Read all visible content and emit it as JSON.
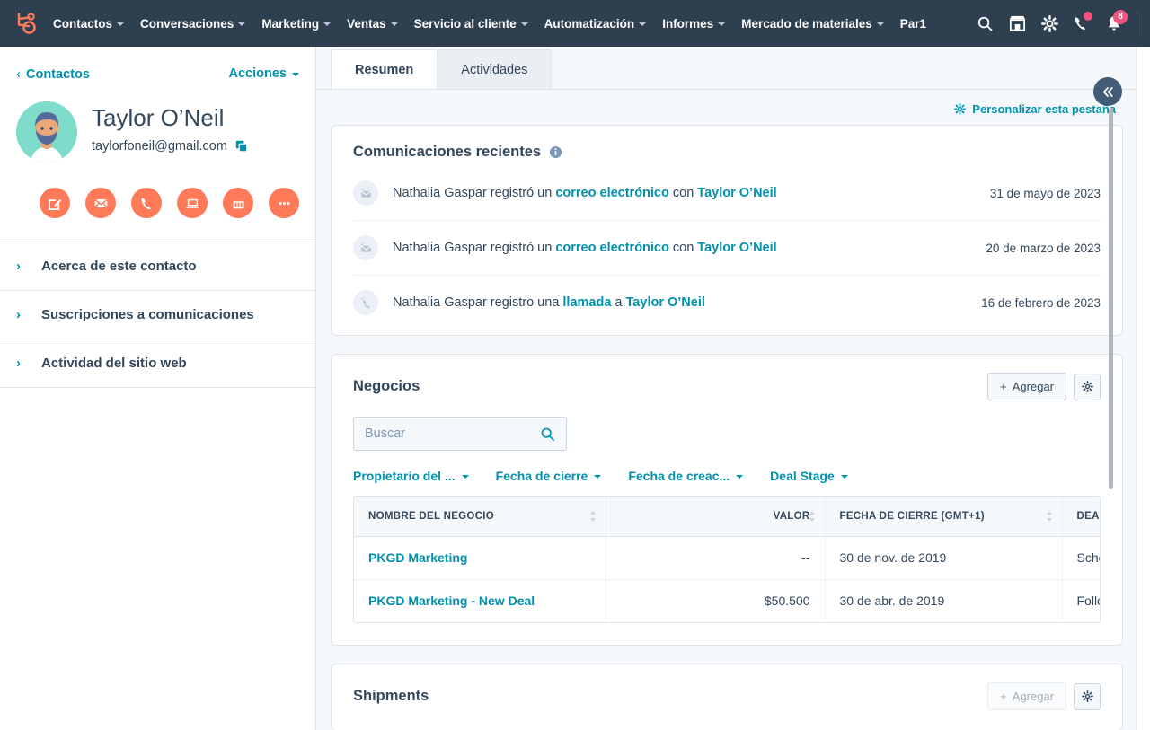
{
  "topnav": {
    "logo_name": "hubspot-logo",
    "menu": [
      {
        "label": "Contactos",
        "has_caret": true
      },
      {
        "label": "Conversaciones",
        "has_caret": true
      },
      {
        "label": "Marketing",
        "has_caret": true
      },
      {
        "label": "Ventas",
        "has_caret": true
      },
      {
        "label": "Servicio al cliente",
        "has_caret": true
      },
      {
        "label": "Automatización",
        "has_caret": true
      },
      {
        "label": "Informes",
        "has_caret": true
      },
      {
        "label": "Mercado de materiales",
        "has_caret": true
      },
      {
        "label": "Par1",
        "has_caret": false
      }
    ],
    "icons": {
      "search": "search-icon",
      "marketplace": "marketplace-icon",
      "settings": "gear-icon",
      "calls": "phone-icon",
      "notifications": "bell-icon"
    },
    "calls_badge": "",
    "notifications_badge": "8",
    "badge_color": "#f2547d",
    "background": "#2e3f50"
  },
  "sidebar": {
    "back_label": "Contactos",
    "actions_label": "Acciones",
    "contact": {
      "name": "Taylor O’Neil",
      "email": "taylorfoneil@gmail.com",
      "avatar_name": "contact-avatar",
      "copy_icon": "copy-icon"
    },
    "quick_actions": [
      {
        "name": "note-button",
        "icon": "note-icon"
      },
      {
        "name": "email-button",
        "icon": "envelope-icon"
      },
      {
        "name": "call-button",
        "icon": "phone-icon"
      },
      {
        "name": "meeting-button",
        "icon": "laptop-icon"
      },
      {
        "name": "task-button",
        "icon": "calendar-icon"
      },
      {
        "name": "more-button",
        "icon": "ellipsis-icon"
      }
    ],
    "sections": [
      {
        "label": "Acerca de este contacto",
        "expanded": false
      },
      {
        "label": "Suscripciones a comunicaciones",
        "expanded": false
      },
      {
        "label": "Actividad del sitio web",
        "expanded": false
      }
    ]
  },
  "main": {
    "tabs": [
      {
        "label": "Resumen",
        "active": true
      },
      {
        "label": "Actividades",
        "active": false
      }
    ],
    "customize_label": "Personalizar esta pestaña",
    "collapse_button": "collapse-panel-button",
    "communications": {
      "title": "Comunicaciones recientes",
      "info_icon": "info-icon",
      "rows": [
        {
          "icon": "logged-email-icon",
          "prefix": "Nathalia Gaspar registró un ",
          "link1": "correo electrónico",
          "middle": " con ",
          "link2": "Taylor O’Neil",
          "date": "31 de mayo de 2023"
        },
        {
          "icon": "logged-email-icon",
          "prefix": "Nathalia Gaspar registró un ",
          "link1": "correo electrónico",
          "middle": " con ",
          "link2": "Taylor O’Neil",
          "date": "20 de marzo de 2023"
        },
        {
          "icon": "logged-call-icon",
          "prefix": "Nathalia Gaspar registro una ",
          "link1": "llamada",
          "middle": " a ",
          "link2": "Taylor O’Neil",
          "date": "16 de febrero de 2023"
        }
      ]
    },
    "deals": {
      "title": "Negocios",
      "add_label": "Agregar",
      "settings_icon": "gear-icon",
      "search_placeholder": "Buscar",
      "search_value": "",
      "search_icon": "search-icon",
      "filters": [
        "Propietario del ...",
        "Fecha de cierre",
        "Fecha de creac...",
        "Deal Stage"
      ],
      "columns": [
        "NOMBRE DEL NEGOCIO",
        "VALOR",
        "FECHA DE CIERRE (GMT+1)",
        "DEAL STAGE"
      ],
      "rows": [
        {
          "name": "PKGD Marketing",
          "value": "--",
          "close_date": "30 de nov. de 2019",
          "stage": "Scheduled"
        },
        {
          "name": "PKGD Marketing - New Deal",
          "value": "$50.500",
          "close_date": "30 de abr. de 2019",
          "stage": "Follow-up"
        }
      ]
    },
    "shipments": {
      "title": "Shipments",
      "add_label": "Agregar",
      "settings_icon": "gear-icon"
    }
  },
  "colors": {
    "navy": "#2e3f50",
    "teal": "#0091ae",
    "orange": "#ff7a59",
    "text": "#33475b",
    "page_bg": "#f5f8fa"
  }
}
